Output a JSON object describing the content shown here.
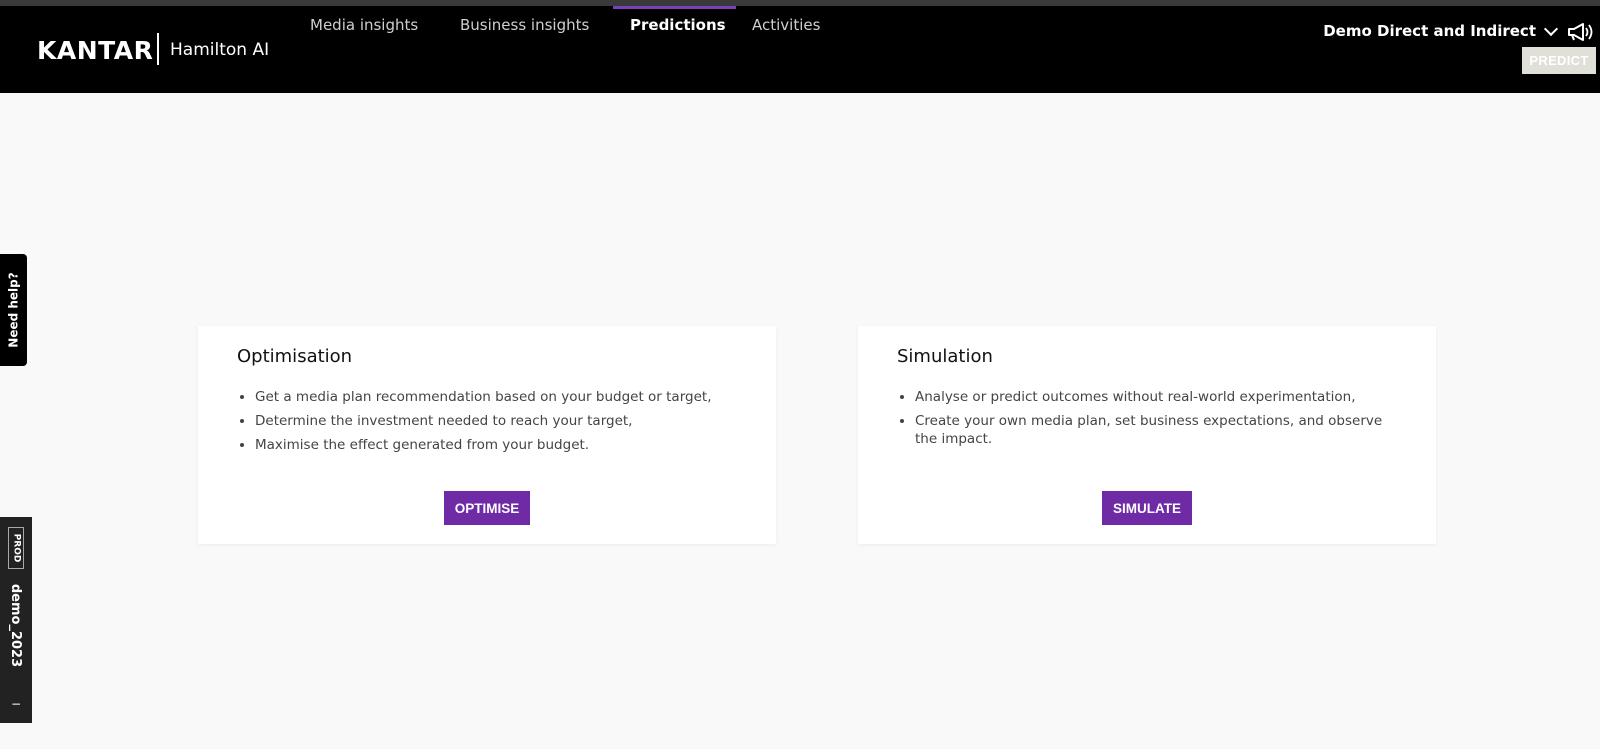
{
  "brand": {
    "logo": "KANTAR",
    "product": "Hamilton AI"
  },
  "nav": {
    "items": [
      {
        "label": "Media insights"
      },
      {
        "label": "Business insights"
      },
      {
        "label": "Predictions",
        "active": true
      },
      {
        "label": "Activities"
      }
    ]
  },
  "project": {
    "name": "Demo Direct and Indirect"
  },
  "header": {
    "predict_label": "PREDICT"
  },
  "help_tab": {
    "label": "Need help?"
  },
  "environment": {
    "badge": "PROD",
    "name": "demo_2023",
    "collapse": "−"
  },
  "cards": {
    "optimisation": {
      "title": "Optimisation",
      "bullets": [
        "Get a media plan recommendation based on your budget or target,",
        "Determine the investment needed to reach your target,",
        "Maximise the effect generated from your budget."
      ],
      "button": "OPTIMISE"
    },
    "simulation": {
      "title": "Simulation",
      "bullets": [
        "Analyse or predict outcomes without real-world experimentation,",
        "Create your own media plan, set business expectations, and observe the impact."
      ],
      "button": "SIMULATE"
    }
  },
  "colors": {
    "accent": "#6f2aa6",
    "header_bg": "#000000",
    "page_bg": "#f9f9f9"
  },
  "icons": {
    "megaphone": "megaphone-icon",
    "project_dropdown": "chevron-down-icon"
  }
}
